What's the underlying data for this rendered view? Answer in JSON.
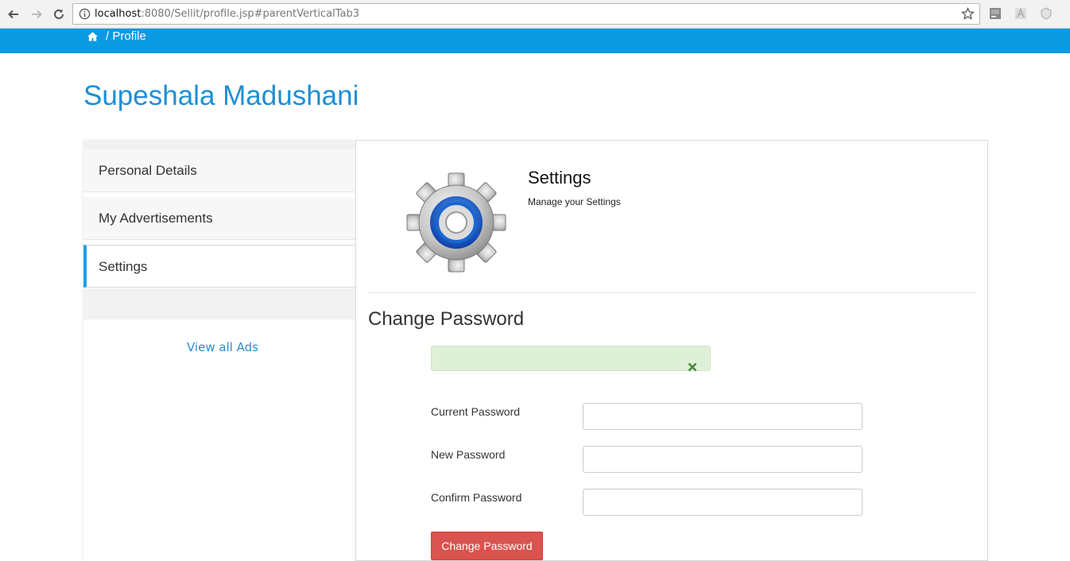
{
  "browser": {
    "url_host": "localhost",
    "url_rest": ":8080/Sellit/profile.jsp#parentVerticalTab3"
  },
  "header": {
    "breadcrumb": "/ Profile",
    "home_icon": "home-icon",
    "bg_color": "#0a9ae2"
  },
  "profile": {
    "name": "Supeshala Madushani"
  },
  "sidebar": {
    "items": [
      {
        "label": "Personal Details",
        "active": false
      },
      {
        "label": "My Advertisements",
        "active": false
      },
      {
        "label": "Settings",
        "active": true
      }
    ],
    "view_all": "View all Ads"
  },
  "settings": {
    "title": "Settings",
    "subtitle": "Manage your Settings",
    "icon": "gear-icon"
  },
  "change_password": {
    "title": "Change Password",
    "alert_close_icon": "close-icon",
    "fields": [
      {
        "label": "Current Password",
        "value": ""
      },
      {
        "label": "New Password",
        "value": ""
      },
      {
        "label": "Confirm Password",
        "value": ""
      }
    ],
    "submit_label": "Change Password",
    "submit_color": "#d9534f"
  }
}
